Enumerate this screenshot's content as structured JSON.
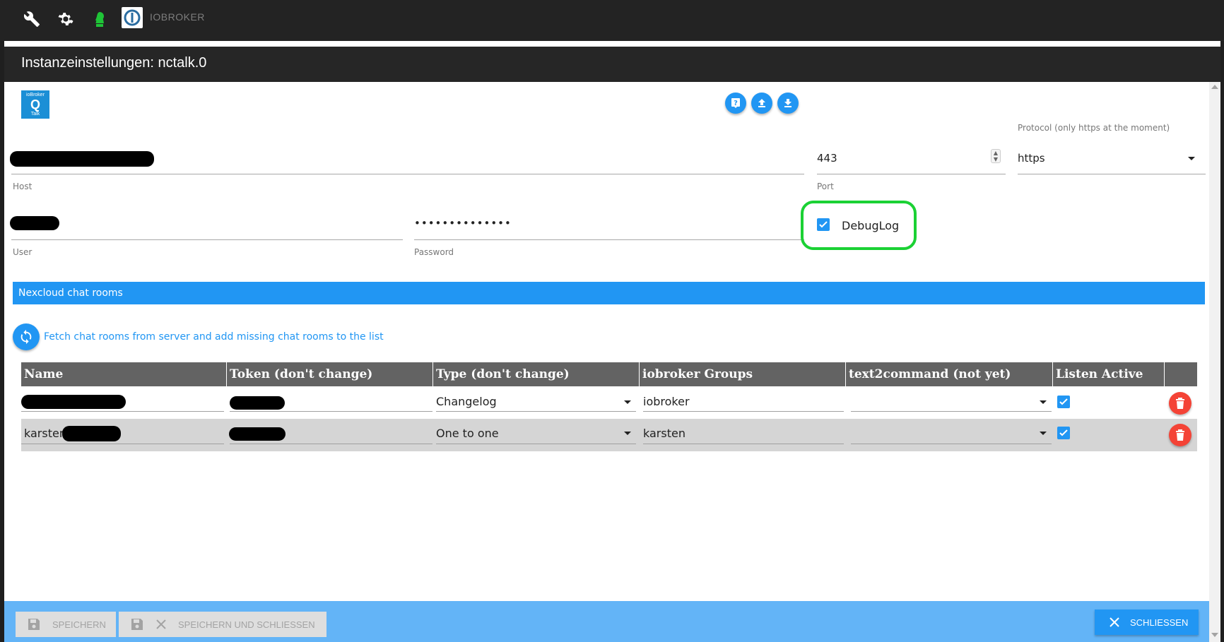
{
  "app": {
    "brand": "IOBROKER"
  },
  "dialog": {
    "title": "Instanzeinstellungen: nctalk.0"
  },
  "adapter_logo": {
    "top": "ioBroker",
    "middle": "Q",
    "bottom": "Talk"
  },
  "toolbar_icons": [
    "wrench-icon",
    "settings-icon",
    "user-icon"
  ],
  "top_buttons": [
    "help-icon",
    "upload-icon",
    "download-icon"
  ],
  "fields": {
    "host": {
      "label": "Host",
      "value": ""
    },
    "port": {
      "label": "Port",
      "value": "443"
    },
    "protocol": {
      "label": "Protocol (only https at the moment)",
      "value": "https"
    },
    "user": {
      "label": "User",
      "value": ""
    },
    "password": {
      "label": "Password",
      "value": "••••••••••••••"
    },
    "debuglog": {
      "label": "DebugLog",
      "checked": true
    }
  },
  "section": {
    "title": "Nexcloud chat rooms"
  },
  "fetch": {
    "label": "Fetch chat rooms from server and add missing chat rooms to the list"
  },
  "table": {
    "headers": [
      "Name",
      "Token (don't change)",
      "Type (don't change)",
      "iobroker Groups",
      "text2command (not yet)",
      "Listen Active"
    ],
    "rows": [
      {
        "name": "",
        "token": "",
        "type": "Changelog",
        "groups": "iobroker",
        "text2command": "",
        "listen_active": true
      },
      {
        "name": "karsten_",
        "token": "",
        "type": "One to one",
        "groups": "karsten",
        "text2command": "",
        "listen_active": true
      }
    ]
  },
  "footer": {
    "save": "SPEICHERN",
    "save_close": "SPEICHERN UND SCHLIESSEN",
    "close": "SCHLIESSEN"
  },
  "colors": {
    "accent": "#2196f3",
    "delete": "#f44336",
    "highlight": "#1bd134",
    "header": "#262626"
  }
}
